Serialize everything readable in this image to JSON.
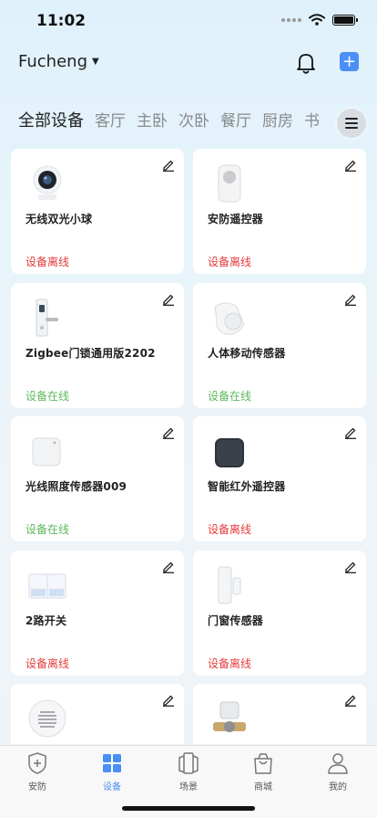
{
  "status_bar": {
    "time": "11:02"
  },
  "header": {
    "home_name": "Fucheng"
  },
  "tabs": [
    {
      "label": "全部设备",
      "active": true
    },
    {
      "label": "客厅"
    },
    {
      "label": "主卧"
    },
    {
      "label": "次卧"
    },
    {
      "label": "餐厅"
    },
    {
      "label": "厨房"
    },
    {
      "label": "书"
    }
  ],
  "devices": [
    {
      "name": "无线双光小球",
      "status": "设备离线",
      "online": false,
      "icon": "camera-ball-icon"
    },
    {
      "name": "安防遥控器",
      "status": "设备离线",
      "online": false,
      "icon": "remote-control-icon"
    },
    {
      "name": "Zigbee门锁通用版2202",
      "status": "设备在线",
      "online": true,
      "icon": "door-lock-icon"
    },
    {
      "name": "人体移动传感器",
      "status": "设备在线",
      "online": true,
      "icon": "motion-sensor-icon"
    },
    {
      "name": "光线照度传感器009",
      "status": "设备在线",
      "online": true,
      "icon": "light-sensor-icon"
    },
    {
      "name": "智能红外遥控器",
      "status": "设备离线",
      "online": false,
      "icon": "ir-remote-icon"
    },
    {
      "name": "2路开关",
      "status": "设备离线",
      "online": false,
      "icon": "two-way-switch-icon"
    },
    {
      "name": "门窗传感器",
      "status": "设备离线",
      "online": false,
      "icon": "door-window-sensor-icon"
    },
    {
      "name": "",
      "status": "",
      "online": false,
      "icon": "speaker-icon"
    },
    {
      "name": "",
      "status": "",
      "online": false,
      "icon": "valve-controller-icon"
    }
  ],
  "tab_bar": [
    {
      "label": "安防",
      "icon": "shield-icon"
    },
    {
      "label": "设备",
      "icon": "grid-icon",
      "active": true
    },
    {
      "label": "场景",
      "icon": "scene-icon"
    },
    {
      "label": "商城",
      "icon": "shop-bag-icon"
    },
    {
      "label": "我的",
      "icon": "person-icon"
    }
  ],
  "colors": {
    "accent": "#4a8ff5",
    "offline": "#e63a3a",
    "online": "#5cb85c"
  }
}
